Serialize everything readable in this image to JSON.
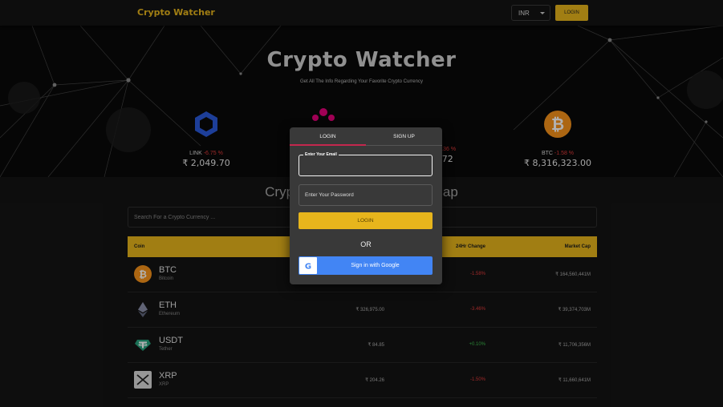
{
  "navbar": {
    "brand": "Crypto Watcher",
    "currency": "INR",
    "login_label": "LOGIN"
  },
  "hero": {
    "title": "Crypto Watcher",
    "subtitle": "Get All The Info Regarding Your Favorite Crypto Currency"
  },
  "carousel": [
    {
      "symbol": "LINK",
      "change": "-6.75 %",
      "price": "₹ 2,049.70"
    },
    {
      "symbol": "",
      "change": "",
      "price": ""
    },
    {
      "symbol": "",
      "change": "-0.36 %",
      "price": ".72"
    },
    {
      "symbol": "BTC",
      "change": "-1.58 %",
      "price": "₹ 8,316,323.00"
    }
  ],
  "main": {
    "title_left": "Cryptoc",
    "title_right": "et Cap",
    "search_placeholder": "Search For a Crypto Currency ..."
  },
  "table": {
    "headers": {
      "coin": "Coin",
      "change": "24Hr Change",
      "mcap": "Market Cap"
    },
    "rows": [
      {
        "symbol": "BTC",
        "name": "Bitcoin",
        "price": "",
        "change": "-1.58%",
        "mcap": "₹ 164,560,441M"
      },
      {
        "symbol": "ETH",
        "name": "Ethereum",
        "price": "₹ 326,975.00",
        "change": "-3.46%",
        "mcap": "₹ 39,374,703M"
      },
      {
        "symbol": "USDT",
        "name": "Tether",
        "price": "₹ 84.85",
        "change": "+0.10%",
        "mcap": "₹ 11,706,356M"
      },
      {
        "symbol": "XRP",
        "name": "XRP",
        "price": "₹ 204.26",
        "change": "-1.50%",
        "mcap": "₹ 11,660,641M"
      }
    ]
  },
  "modal": {
    "tab_login": "LOGIN",
    "tab_signup": "SIGN UP",
    "email_label": "Enter Your Email",
    "password_label": "Enter Your Password",
    "login_label": "LOGIN",
    "or_label": "OR",
    "google_label": "Sign in with Google"
  },
  "colors": {
    "accent": "#e7b51c",
    "negative": "#e23b3b",
    "positive": "#3cbd4c",
    "google": "#4285f4",
    "tab_indicator": "#c4274e"
  }
}
